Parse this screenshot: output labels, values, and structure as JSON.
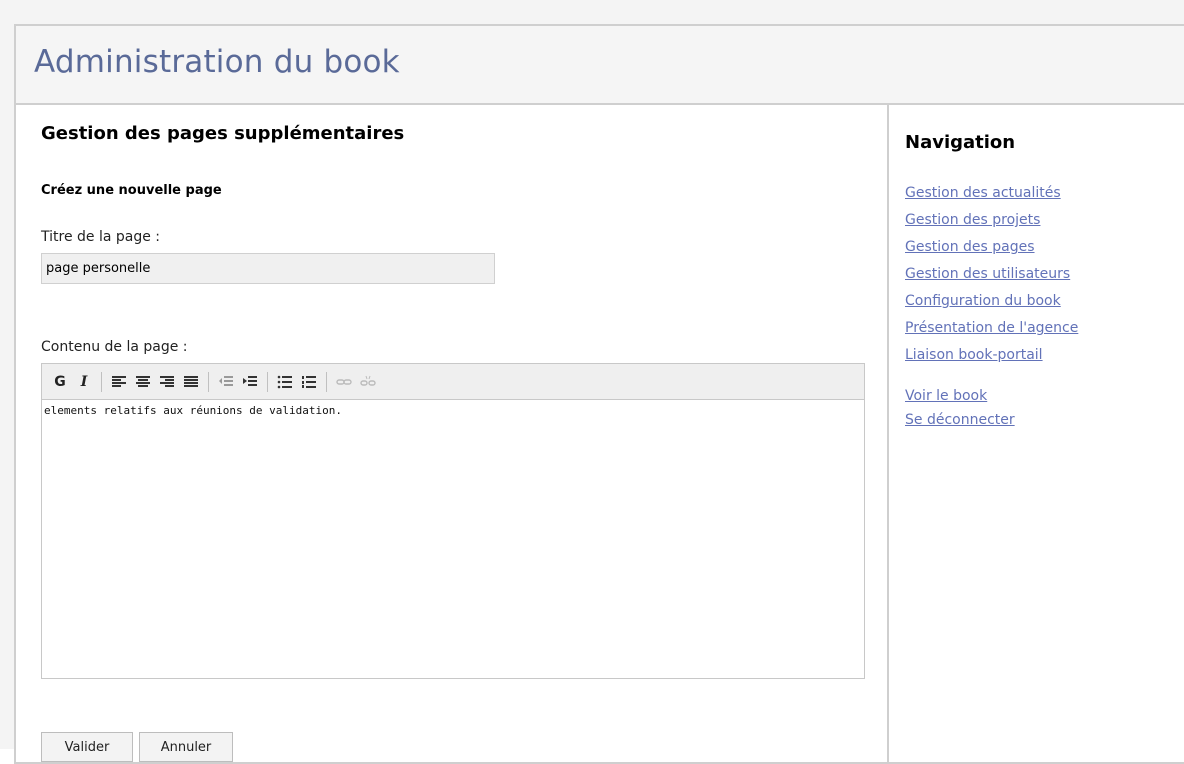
{
  "header": {
    "title": "Administration du book"
  },
  "main": {
    "section_title": "Gestion des pages supplémentaires",
    "subsection_title": "Créez une nouvelle page",
    "title_label": "Titre de la page :",
    "title_value": "page personelle",
    "content_label": "Contenu de la page :",
    "content_value": "elements relatifs aux réunions de validation.",
    "toolbar": {
      "bold_label": "G",
      "italic_label": "I"
    },
    "buttons": {
      "validate": "Valider",
      "cancel": "Annuler"
    }
  },
  "sidebar": {
    "title": "Navigation",
    "links": [
      "Gestion des actualités",
      "Gestion des projets",
      "Gestion des pages",
      "Gestion des utilisateurs",
      "Configuration du book",
      "Présentation de l'agence",
      "Liaison book-portail"
    ],
    "secondary_links": [
      "Voir le book",
      "Se déconnecter"
    ]
  },
  "colors": {
    "title_blue": "#5a6a98",
    "link_blue": "#6272b8",
    "border_gray": "#cfcfcf"
  }
}
